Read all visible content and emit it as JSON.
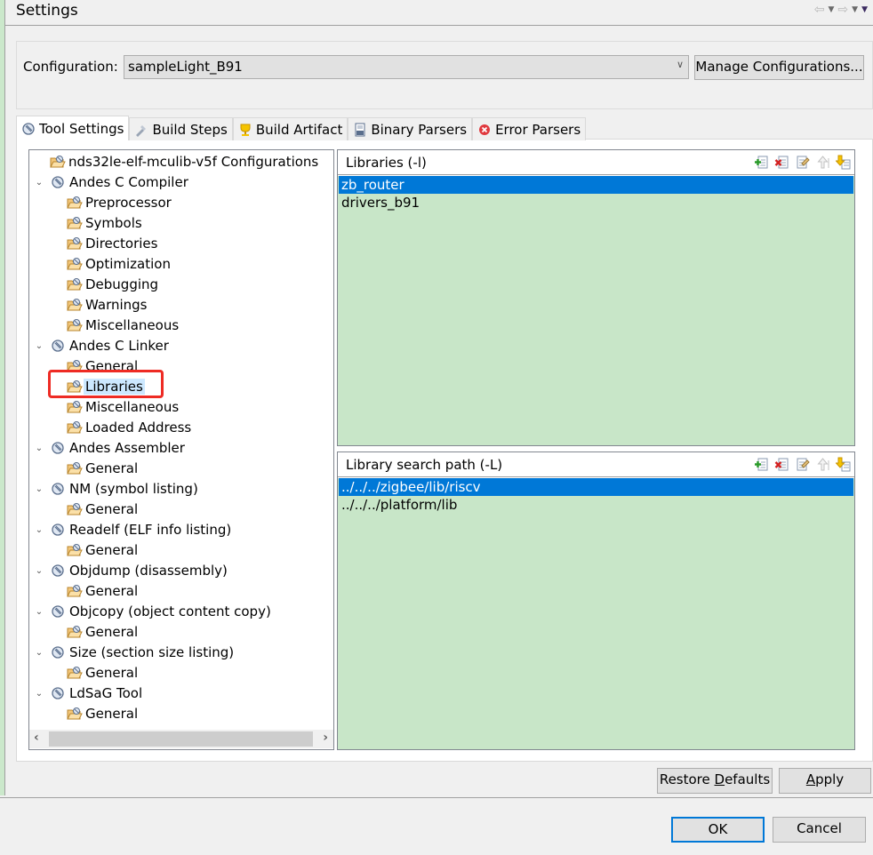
{
  "window": {
    "title": "Settings",
    "nav": {
      "back": "back-arrow",
      "forward": "forward-arrow"
    }
  },
  "configuration": {
    "label": "Configuration:",
    "value": "sampleLight_B91",
    "manage_label": "Manage Configurations..."
  },
  "tabs": [
    {
      "label": "Tool Settings",
      "icon": "tool-settings-icon",
      "active": true
    },
    {
      "label": "Build Steps",
      "icon": "build-steps-icon"
    },
    {
      "label": "Build Artifact",
      "icon": "build-artifact-icon"
    },
    {
      "label": "Binary Parsers",
      "icon": "binary-parsers-icon"
    },
    {
      "label": "Error Parsers",
      "icon": "error-parsers-icon"
    }
  ],
  "tree": [
    {
      "label": "nds32le-elf-mculib-v5f Configurations",
      "level": 1,
      "type": "option"
    },
    {
      "label": "Andes C Compiler",
      "level": 0,
      "type": "tool",
      "expanded": true
    },
    {
      "label": "Preprocessor",
      "level": 2,
      "type": "option"
    },
    {
      "label": "Symbols",
      "level": 2,
      "type": "option"
    },
    {
      "label": "Directories",
      "level": 2,
      "type": "option"
    },
    {
      "label": "Optimization",
      "level": 2,
      "type": "option"
    },
    {
      "label": "Debugging",
      "level": 2,
      "type": "option"
    },
    {
      "label": "Warnings",
      "level": 2,
      "type": "option"
    },
    {
      "label": "Miscellaneous",
      "level": 2,
      "type": "option"
    },
    {
      "label": "Andes C Linker",
      "level": 0,
      "type": "tool",
      "expanded": true
    },
    {
      "label": "General",
      "level": 2,
      "type": "option"
    },
    {
      "label": "Libraries",
      "level": 2,
      "type": "option",
      "selected": true
    },
    {
      "label": "Miscellaneous",
      "level": 2,
      "type": "option"
    },
    {
      "label": "Loaded Address",
      "level": 2,
      "type": "option"
    },
    {
      "label": "Andes Assembler",
      "level": 0,
      "type": "tool",
      "expanded": true
    },
    {
      "label": "General",
      "level": 2,
      "type": "option"
    },
    {
      "label": "NM (symbol listing)",
      "level": 0,
      "type": "tool",
      "expanded": true
    },
    {
      "label": "General",
      "level": 2,
      "type": "option"
    },
    {
      "label": "Readelf (ELF info listing)",
      "level": 0,
      "type": "tool",
      "expanded": true
    },
    {
      "label": "General",
      "level": 2,
      "type": "option"
    },
    {
      "label": "Objdump (disassembly)",
      "level": 0,
      "type": "tool",
      "expanded": true
    },
    {
      "label": "General",
      "level": 2,
      "type": "option"
    },
    {
      "label": "Objcopy (object content copy)",
      "level": 0,
      "type": "tool",
      "expanded": true
    },
    {
      "label": "General",
      "level": 2,
      "type": "option"
    },
    {
      "label": "Size (section size listing)",
      "level": 0,
      "type": "tool",
      "expanded": true
    },
    {
      "label": "General",
      "level": 2,
      "type": "option"
    },
    {
      "label": "LdSaG Tool",
      "level": 0,
      "type": "tool",
      "expanded": true
    },
    {
      "label": "General",
      "level": 2,
      "type": "option"
    }
  ],
  "libraries_panel": {
    "title": "Libraries (-l)",
    "items": [
      "zb_router",
      "drivers_b91"
    ],
    "selected_index": 0,
    "tools": [
      "add",
      "delete",
      "edit",
      "move-up",
      "move-down"
    ]
  },
  "search_path_panel": {
    "title": "Library search path (-L)",
    "items": [
      "../../../zigbee/lib/riscv",
      "../../../platform/lib"
    ],
    "selected_index": 0,
    "tools": [
      "add",
      "delete",
      "edit",
      "move-up",
      "move-down"
    ]
  },
  "buttons": {
    "restore_pre": "Restore ",
    "restore_mnemonic": "D",
    "restore_post": "efaults",
    "apply_mnemonic": "A",
    "apply_post": "pply",
    "ok": "OK",
    "cancel": "Cancel"
  },
  "colors": {
    "selection": "#0078d7",
    "list_bg": "#c8e6c8",
    "tree_selected": "#cce8ff",
    "highlight": "#ee2b24"
  }
}
